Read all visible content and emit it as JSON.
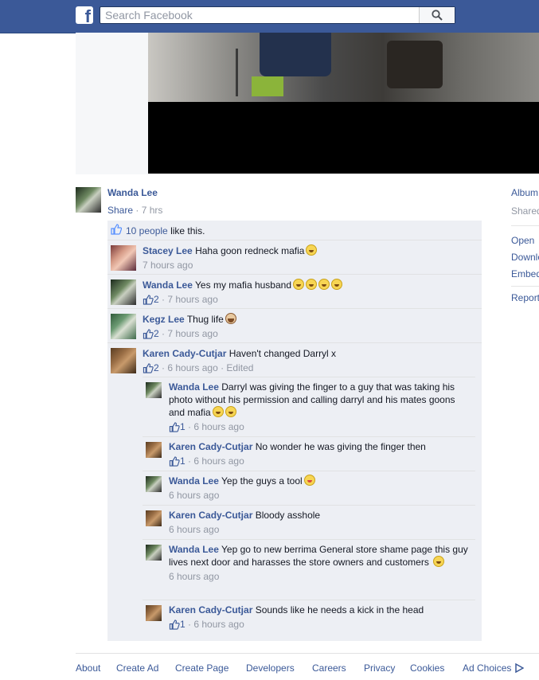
{
  "search": {
    "placeholder": "Search Facebook"
  },
  "post": {
    "author": "Wanda Lee",
    "share": "Share",
    "time": "7 hrs",
    "likes_count": "10 people",
    "likes_text": "like this."
  },
  "right_col": {
    "album": "Album",
    "shared": "Shared",
    "open": "Open",
    "download": "Download",
    "embed": "Embed",
    "report": "Report"
  },
  "comments": [
    {
      "name": "Stacey Lee",
      "text": "Haha goon redneck mafia",
      "likes": "",
      "time": "7 hours ago"
    },
    {
      "name": "Wanda Lee",
      "text": "Yes my mafia husband",
      "likes": "2",
      "time": "7 hours ago"
    },
    {
      "name": "Kegz Lee",
      "text": "Thug life",
      "likes": "2",
      "time": "7 hours ago"
    },
    {
      "name": "Karen Cady-Cutjar",
      "text": "Haven't changed Darryl x",
      "likes": "2",
      "time": "6 hours ago",
      "edited": "Edited"
    }
  ],
  "replies": [
    {
      "name": "Wanda Lee",
      "text": "Darryl was giving the finger to a guy that was taking his photo without his permission and calling darryl and his mates goons and mafia",
      "likes": "1",
      "time": "6 hours ago"
    },
    {
      "name": "Karen Cady-Cutjar",
      "text": "No wonder he was giving the finger then",
      "likes": "1",
      "time": "6 hours ago"
    },
    {
      "name": "Wanda Lee",
      "text": "Yep the guys a tool",
      "likes": "",
      "time": "6 hours ago"
    },
    {
      "name": "Karen Cady-Cutjar",
      "text": "Bloody asshole",
      "likes": "",
      "time": "6 hours ago"
    },
    {
      "name": "Wanda Lee",
      "text": "Yep go to new berrima General store shame page this guy lives next door and harasses the store owners and customers",
      "likes": "",
      "time": "6 hours ago"
    },
    {
      "name": "Karen Cady-Cutjar",
      "text": "Sounds like he needs a kick in the head",
      "likes": "1",
      "time": "6 hours ago"
    }
  ],
  "footer": [
    "About",
    "Create Ad",
    "Create Page",
    "Developers",
    "Careers",
    "Privacy",
    "Cookies",
    "Ad Choices"
  ],
  "colors": {
    "brand": "#3b5998",
    "comment_bg": "#edeff4"
  }
}
